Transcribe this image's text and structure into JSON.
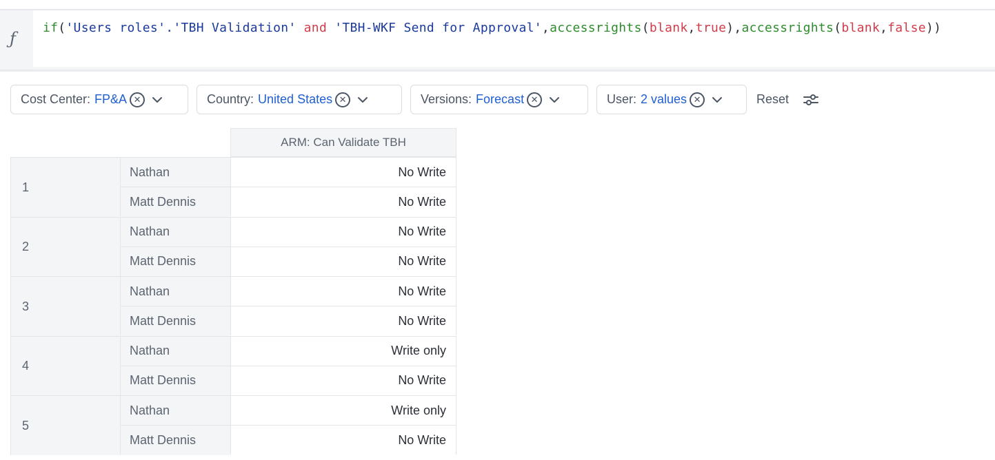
{
  "formula": {
    "icon": "function-icon",
    "tokens": [
      {
        "t": "if",
        "c": "tk-fn"
      },
      {
        "t": "(",
        "c": "tk-punc"
      },
      {
        "t": "'Users roles'.'TBH Validation'",
        "c": "tk-str"
      },
      {
        "t": " and ",
        "c": "tk-kw"
      },
      {
        "t": "'TBH-WKF Send for Approval'",
        "c": "tk-str"
      },
      {
        "t": ",",
        "c": "tk-punc"
      },
      {
        "t": "accessrights",
        "c": "tk-fn"
      },
      {
        "t": "(",
        "c": "tk-punc"
      },
      {
        "t": "blank",
        "c": "tk-kw"
      },
      {
        "t": ",",
        "c": "tk-punc"
      },
      {
        "t": "true",
        "c": "tk-kw"
      },
      {
        "t": "),",
        "c": "tk-punc"
      },
      {
        "t": "accessrights",
        "c": "tk-fn"
      },
      {
        "t": "(",
        "c": "tk-punc"
      },
      {
        "t": "blank",
        "c": "tk-kw"
      },
      {
        "t": ",",
        "c": "tk-punc"
      },
      {
        "t": "false",
        "c": "tk-kw"
      },
      {
        "t": "))",
        "c": "tk-punc"
      }
    ]
  },
  "filters": [
    {
      "label": "Cost Center:",
      "value": "FP&A"
    },
    {
      "label": "Country:",
      "value": "United States"
    },
    {
      "label": "Versions:",
      "value": "Forecast"
    },
    {
      "label": "User:",
      "value": "2 values"
    }
  ],
  "reset_label": "Reset",
  "colors": {
    "accent": "#1f5fd1",
    "fn": "#2e8b2e",
    "string": "#1a3a9c",
    "keyword": "#d23c4a"
  },
  "table": {
    "column_header": "ARM: Can Validate TBH",
    "groups": [
      {
        "label": "1",
        "rows": [
          {
            "name": "Nathan",
            "value": "No Write"
          },
          {
            "name": "Matt Dennis",
            "value": "No Write"
          }
        ]
      },
      {
        "label": "2",
        "rows": [
          {
            "name": "Nathan",
            "value": "No Write"
          },
          {
            "name": "Matt Dennis",
            "value": "No Write"
          }
        ]
      },
      {
        "label": "3",
        "rows": [
          {
            "name": "Nathan",
            "value": "No Write"
          },
          {
            "name": "Matt Dennis",
            "value": "No Write"
          }
        ]
      },
      {
        "label": "4",
        "rows": [
          {
            "name": "Nathan",
            "value": "Write only"
          },
          {
            "name": "Matt Dennis",
            "value": "No Write"
          }
        ]
      },
      {
        "label": "5",
        "rows": [
          {
            "name": "Nathan",
            "value": "Write only"
          },
          {
            "name": "Matt Dennis",
            "value": "No Write"
          }
        ]
      }
    ]
  }
}
